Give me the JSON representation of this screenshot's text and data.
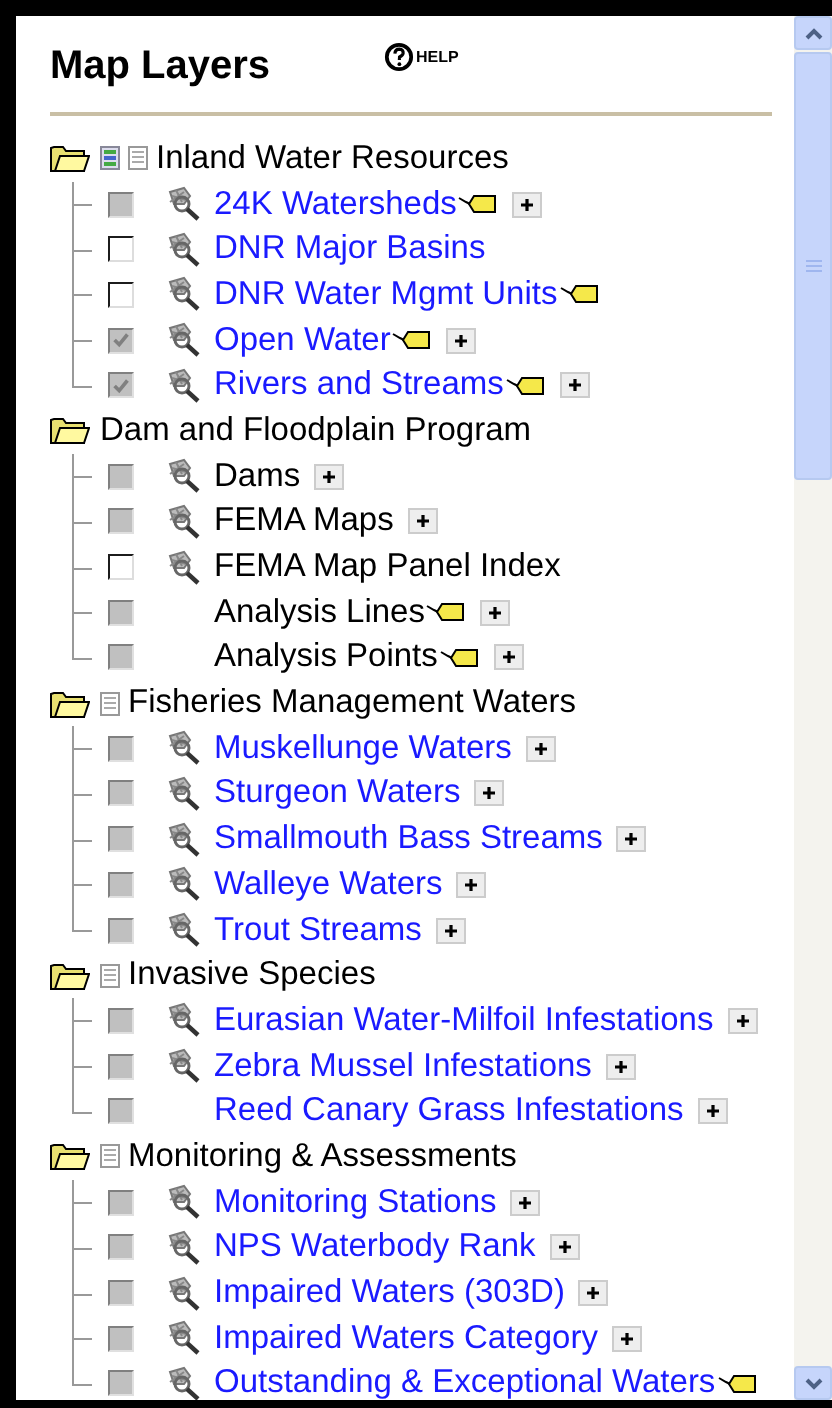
{
  "panel": {
    "title": "Map Layers",
    "help": "HELP"
  },
  "groups": [
    {
      "label": "Inland Water Resources",
      "legend_icon": true,
      "doc_icon": true,
      "items": [
        {
          "label": "24K Watersheds",
          "link": true,
          "checked": false,
          "disabled": true,
          "scale_icon": true,
          "tag": true,
          "expand": true
        },
        {
          "label": "DNR Major Basins",
          "link": true,
          "checked": false,
          "disabled": false,
          "scale_icon": true,
          "tag": false,
          "expand": false
        },
        {
          "label": "DNR Water Mgmt Units",
          "link": true,
          "checked": false,
          "disabled": false,
          "scale_icon": true,
          "tag": true,
          "expand": false
        },
        {
          "label": "Open Water",
          "link": true,
          "checked": true,
          "disabled": true,
          "scale_icon": true,
          "tag": true,
          "expand": true
        },
        {
          "label": "Rivers and Streams",
          "link": true,
          "checked": true,
          "disabled": true,
          "scale_icon": true,
          "tag": true,
          "expand": true
        }
      ]
    },
    {
      "label": "Dam and Floodplain Program",
      "legend_icon": false,
      "doc_icon": false,
      "items": [
        {
          "label": "Dams",
          "link": false,
          "checked": false,
          "disabled": true,
          "scale_icon": true,
          "tag": false,
          "expand": true
        },
        {
          "label": "FEMA Maps",
          "link": false,
          "checked": false,
          "disabled": true,
          "scale_icon": true,
          "tag": false,
          "expand": true
        },
        {
          "label": "FEMA Map Panel Index",
          "link": false,
          "checked": false,
          "disabled": false,
          "scale_icon": true,
          "tag": false,
          "expand": false
        },
        {
          "label": "Analysis Lines",
          "link": false,
          "checked": false,
          "disabled": true,
          "scale_icon": false,
          "tag": true,
          "expand": true
        },
        {
          "label": "Analysis Points",
          "link": false,
          "checked": false,
          "disabled": true,
          "scale_icon": false,
          "tag": true,
          "expand": true
        }
      ]
    },
    {
      "label": "Fisheries Management Waters",
      "legend_icon": false,
      "doc_icon": true,
      "items": [
        {
          "label": "Muskellunge Waters",
          "link": true,
          "checked": false,
          "disabled": true,
          "scale_icon": true,
          "tag": false,
          "expand": true
        },
        {
          "label": "Sturgeon Waters",
          "link": true,
          "checked": false,
          "disabled": true,
          "scale_icon": true,
          "tag": false,
          "expand": true
        },
        {
          "label": "Smallmouth Bass Streams",
          "link": true,
          "checked": false,
          "disabled": true,
          "scale_icon": true,
          "tag": false,
          "expand": true
        },
        {
          "label": "Walleye Waters",
          "link": true,
          "checked": false,
          "disabled": true,
          "scale_icon": true,
          "tag": false,
          "expand": true
        },
        {
          "label": "Trout Streams",
          "link": true,
          "checked": false,
          "disabled": true,
          "scale_icon": true,
          "tag": false,
          "expand": true
        }
      ]
    },
    {
      "label": "Invasive Species",
      "legend_icon": false,
      "doc_icon": true,
      "items": [
        {
          "label": "Eurasian Water-Milfoil Infestations",
          "link": true,
          "checked": false,
          "disabled": true,
          "scale_icon": true,
          "tag": false,
          "expand": true
        },
        {
          "label": "Zebra Mussel Infestations",
          "link": true,
          "checked": false,
          "disabled": true,
          "scale_icon": true,
          "tag": false,
          "expand": true
        },
        {
          "label": "Reed Canary Grass Infestations",
          "link": true,
          "checked": false,
          "disabled": true,
          "scale_icon": false,
          "tag": false,
          "expand": true
        }
      ]
    },
    {
      "label": "Monitoring & Assessments",
      "legend_icon": false,
      "doc_icon": true,
      "items": [
        {
          "label": "Monitoring Stations",
          "link": true,
          "checked": false,
          "disabled": true,
          "scale_icon": true,
          "tag": false,
          "expand": true
        },
        {
          "label": "NPS Waterbody Rank",
          "link": true,
          "checked": false,
          "disabled": true,
          "scale_icon": true,
          "tag": false,
          "expand": true
        },
        {
          "label": "Impaired Waters (303D)",
          "link": true,
          "checked": false,
          "disabled": true,
          "scale_icon": true,
          "tag": false,
          "expand": true
        },
        {
          "label": "Impaired Waters Category",
          "link": true,
          "checked": false,
          "disabled": true,
          "scale_icon": true,
          "tag": false,
          "expand": true
        },
        {
          "label": "Outstanding & Exceptional Waters",
          "link": true,
          "checked": false,
          "disabled": true,
          "scale_icon": true,
          "tag": true,
          "expand": false
        }
      ]
    }
  ]
}
